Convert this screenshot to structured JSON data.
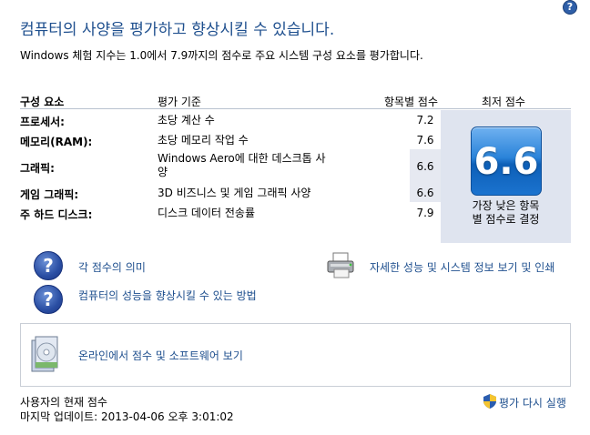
{
  "header": {
    "title": "컴퓨터의 사양을 평가하고 향상시킬 수 있습니다.",
    "subtitle": "Windows 체험 지수는 1.0에서 7.9까지의 점수로 주요 시스템 구성 요소를 평가합니다."
  },
  "table": {
    "columns": {
      "component": "구성 요소",
      "criteria": "평가 기준",
      "subscore": "항목별 점수",
      "basescore": "최저 점수"
    },
    "rows": [
      {
        "name": "프로세서:",
        "desc": "초당 계산 수",
        "score": "7.2"
      },
      {
        "name": "메모리(RAM):",
        "desc": "초당 메모리 작업 수",
        "score": "7.6"
      },
      {
        "name": "그래픽:",
        "desc": "Windows Aero에 대한 데스크톱 사양",
        "score": "6.6"
      },
      {
        "name": "게임 그래픽:",
        "desc": "3D 비즈니스 및 게임 그래픽 사양",
        "score": "6.6"
      },
      {
        "name": "주 하드 디스크:",
        "desc": "디스크 데이터 전송률",
        "score": "7.9"
      }
    ],
    "base_score": "6.6",
    "base_caption": "가장 낮은 항목\n별 점수로 결정"
  },
  "links": {
    "meaning": "각 점수의 의미",
    "improve": "컴퓨터의 성능을 향상시킬 수 있는 방법",
    "details": "자세한 성능 및 시스템 정보 보기 및 인쇄",
    "online": "온라인에서 점수 및 소프트웨어 보기"
  },
  "footer": {
    "current_label": "사용자의 현재 점수",
    "last_update": "마지막 업데이트: 2013-04-06 오후 3:01:02",
    "rerun": "평가 다시 실행"
  },
  "icons": {
    "help": "help-icon",
    "question": "question-icon",
    "printer": "printer-icon",
    "cd": "cd-software-icon",
    "shield": "uac-shield-icon"
  },
  "colors": {
    "title": "#1e4f8e",
    "link": "#1e4f8e",
    "base_panel": "#dfe4ef"
  }
}
